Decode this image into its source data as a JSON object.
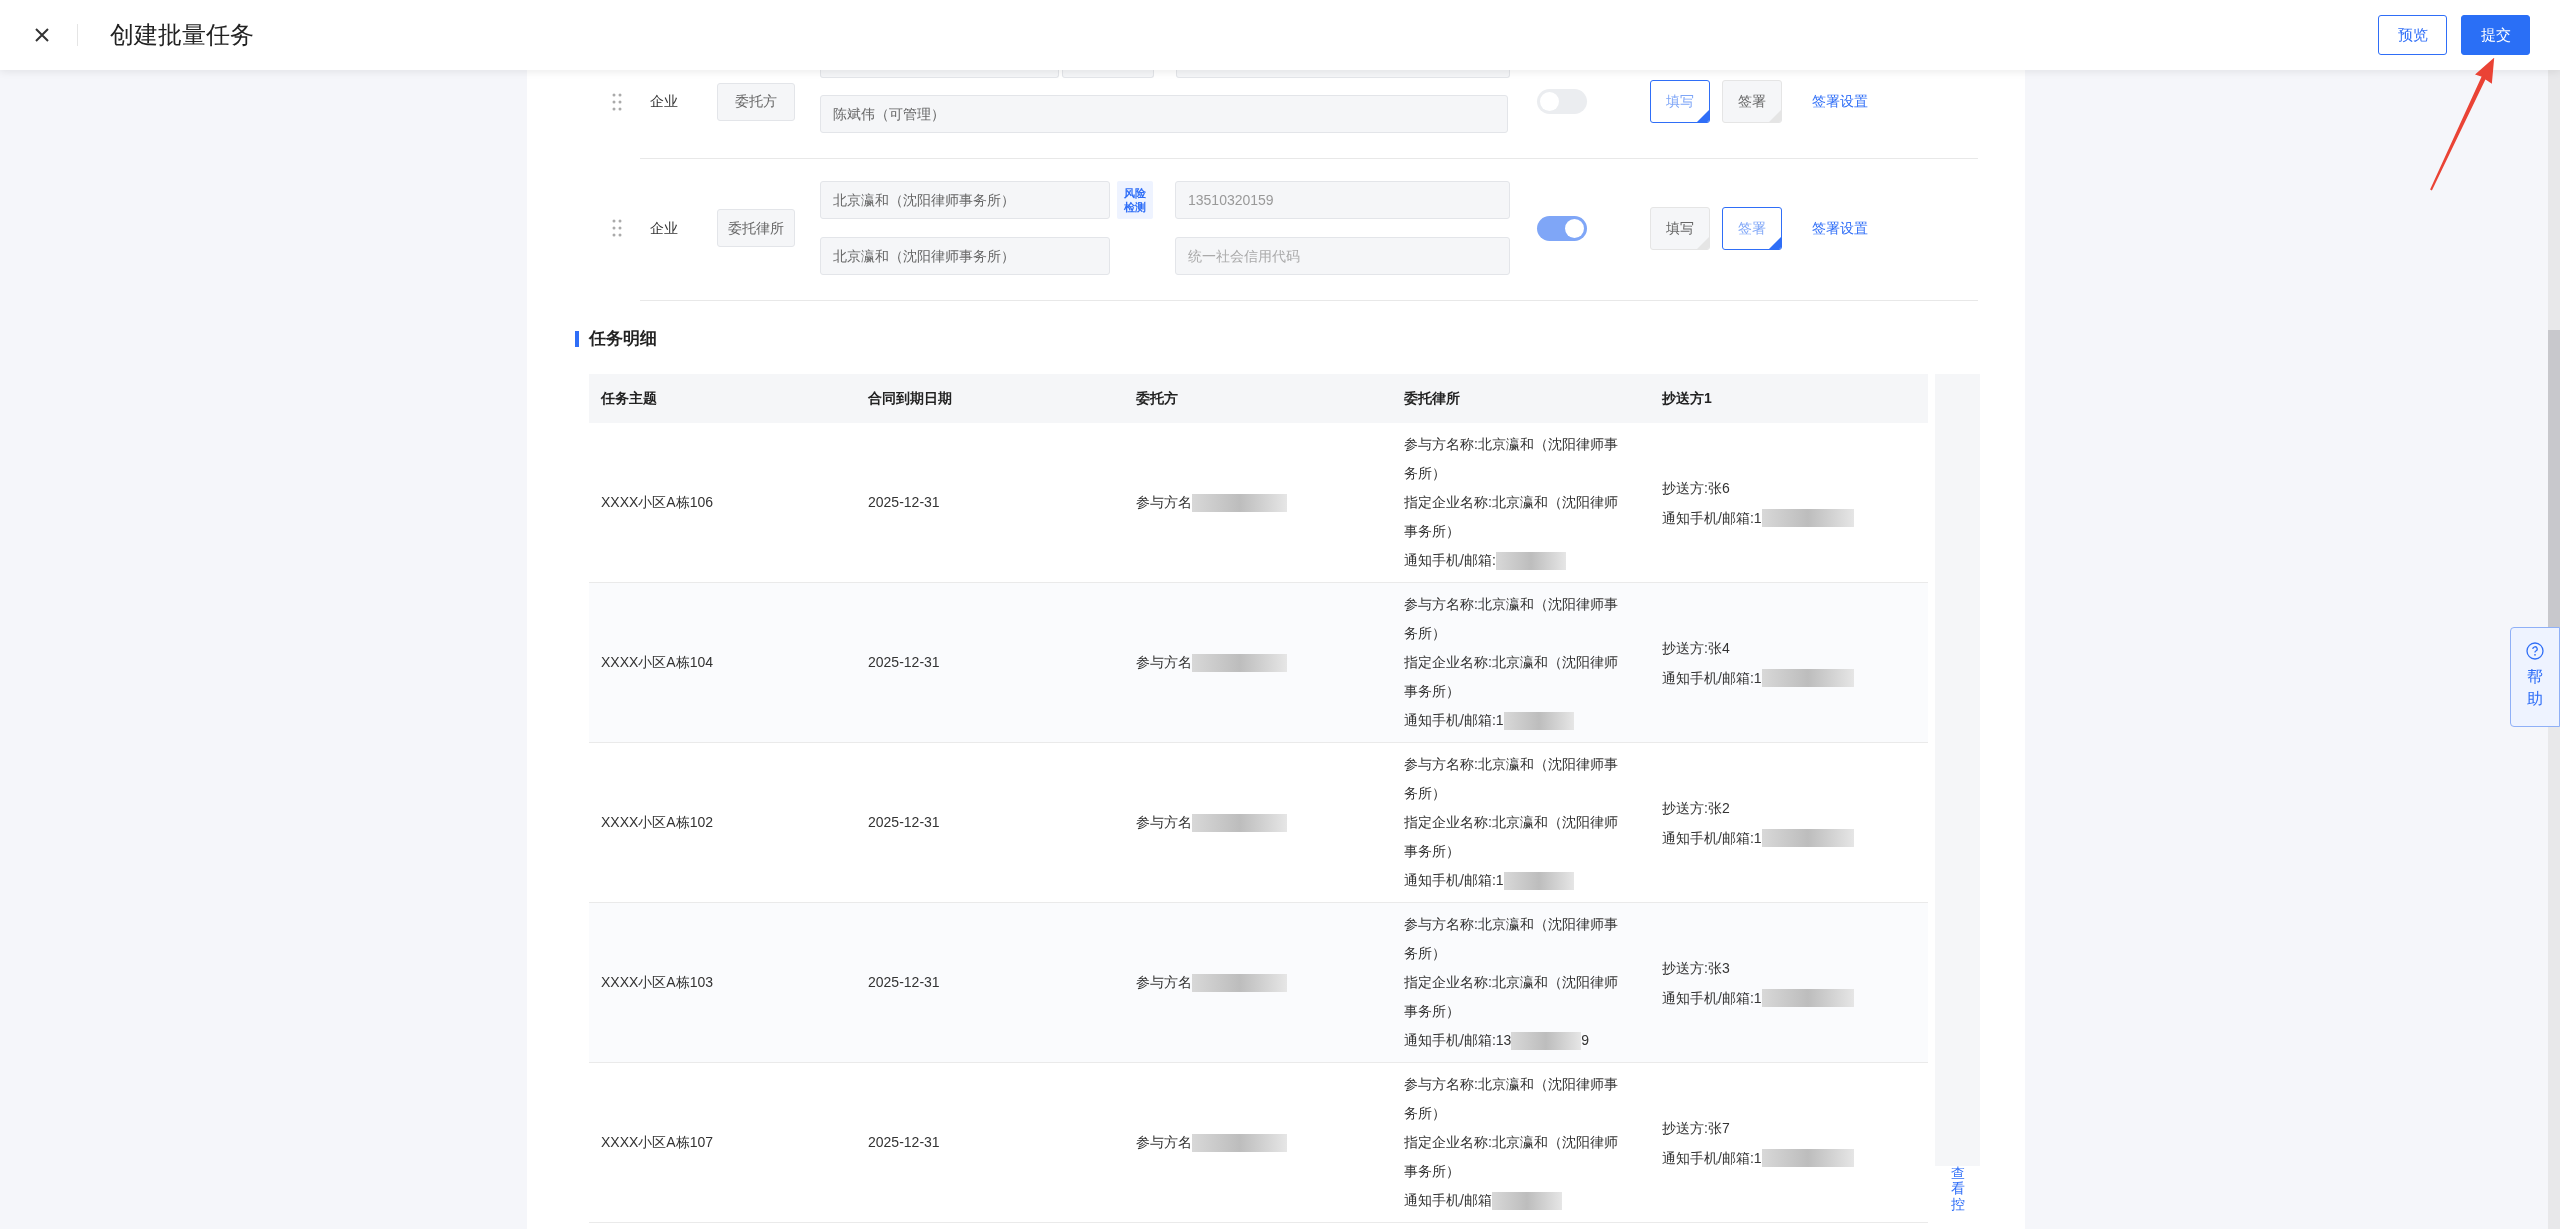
{
  "header": {
    "title": "创建批量任务",
    "buttons": [
      {
        "label": "预览",
        "kind": "outline"
      },
      {
        "label": "提交",
        "kind": "primary"
      }
    ]
  },
  "signers": [
    {
      "type": "企业",
      "role": "委托方",
      "manager": "陈斌伟（可管理）",
      "on": false,
      "actions": [
        {
          "label": "填写",
          "selected": true
        },
        {
          "label": "签署",
          "selected": false
        }
      ],
      "settings_link": "签署设置"
    },
    {
      "type": "企业",
      "role": "委托律所",
      "name": "北京瀛和（沈阳律师事务所）",
      "risk_badge": "风险检测",
      "phone": "13510320159",
      "company": "北京瀛和（沈阳律师事务所）",
      "credit_code_placeholder": "统一社会信用代码",
      "on": true,
      "actions": [
        {
          "label": "填写",
          "selected": false
        },
        {
          "label": "签署",
          "selected": true
        }
      ],
      "settings_link": "签署设置"
    }
  ],
  "section_title": "任务明细",
  "table": {
    "columns": [
      "任务主题",
      "合同到期日期",
      "委托方",
      "委托律所",
      "抄送方1"
    ],
    "rows": [
      {
        "subject": "XXXX小区A栋106",
        "due_date": "2025-12-31",
        "client": "参与方名",
        "firm_name": "参与方名称:北京瀛和（沈阳律师事务所）",
        "firm_company": "指定企业名称:北京瀛和（沈阳律师事务所）",
        "firm_contact": "通知手机/邮箱:",
        "cc_name": "抄送方:张6",
        "cc_contact": "通知手机/邮箱:1"
      },
      {
        "subject": "XXXX小区A栋104",
        "due_date": "2025-12-31",
        "client": "参与方名",
        "firm_name": "参与方名称:北京瀛和（沈阳律师事务所）",
        "firm_company": "指定企业名称:北京瀛和（沈阳律师事务所）",
        "firm_contact": "通知手机/邮箱:1",
        "cc_name": "抄送方:张4",
        "cc_contact": "通知手机/邮箱:1"
      },
      {
        "subject": "XXXX小区A栋102",
        "due_date": "2025-12-31",
        "client": "参与方名",
        "firm_name": "参与方名称:北京瀛和（沈阳律师事务所）",
        "firm_company": "指定企业名称:北京瀛和（沈阳律师事务所）",
        "firm_contact": "通知手机/邮箱:1",
        "cc_name": "抄送方:张2",
        "cc_contact": "通知手机/邮箱:1"
      },
      {
        "subject": "XXXX小区A栋103",
        "due_date": "2025-12-31",
        "client": "参与方名",
        "firm_name": "参与方名称:北京瀛和（沈阳律师事务所）",
        "firm_company": "指定企业名称:北京瀛和（沈阳律师事务所）",
        "firm_contact": "通知手机/邮箱:13",
        "firm_contact_end": "9",
        "cc_name": "抄送方:张3",
        "cc_contact": "通知手机/邮箱:1"
      },
      {
        "subject": "XXXX小区A栋107",
        "due_date": "2025-12-31",
        "client": "参与方名",
        "firm_name": "参与方名称:北京瀛和（沈阳律师事务所）",
        "firm_company": "指定企业名称:北京瀛和（沈阳律师事务所）",
        "firm_contact": "通知手机/邮箱",
        "cc_name": "抄送方:张7",
        "cc_contact": "通知手机/邮箱:1"
      }
    ],
    "side_link": "查看控"
  },
  "help_tab": "帮助"
}
